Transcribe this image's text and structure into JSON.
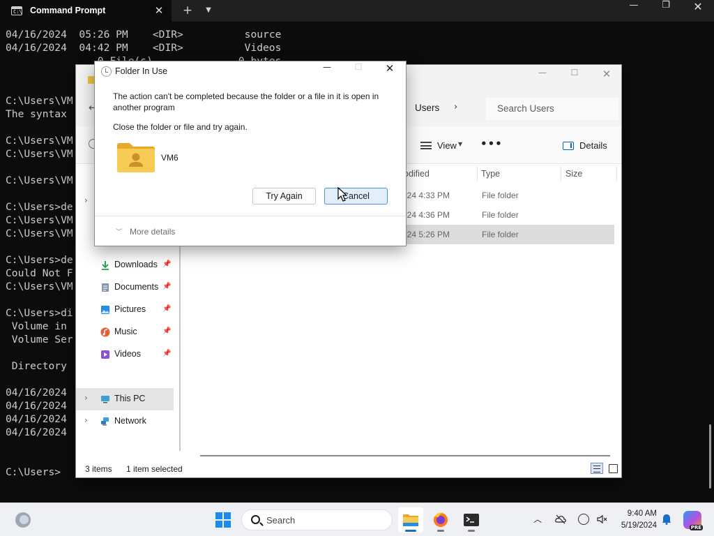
{
  "terminal": {
    "tab_title": "Command Prompt",
    "tab_icon_text": "C:\\",
    "lines": [
      "04/16/2024  05:26 PM    <DIR>          source",
      "04/16/2024  04:42 PM    <DIR>          Videos",
      "               0 File(s)              0 bytes",
      "",
      "",
      "C:\\Users\\VM",
      "The syntax",
      "",
      "C:\\Users\\VM",
      "C:\\Users\\VM",
      "",
      "C:\\Users\\VM",
      "",
      "C:\\Users>de",
      "C:\\Users\\VM",
      "C:\\Users\\VM",
      "",
      "C:\\Users>de",
      "Could Not F",
      "C:\\Users\\VM",
      "",
      "C:\\Users>di",
      " Volume in ",
      " Volume Ser",
      "",
      " Directory ",
      "",
      "04/16/2024",
      "04/16/2024",
      "04/16/2024",
      "04/16/2024",
      "",
      "",
      "C:\\Users>"
    ]
  },
  "explorer": {
    "breadcrumb": "Users",
    "search_placeholder": "Search Users",
    "toolbar": {
      "view_label": "View",
      "more_label": "•••",
      "details_label": "Details"
    },
    "nav": {
      "items": [
        {
          "label": "Downloads",
          "icon": "download-icon",
          "color": "#1f9e4b",
          "pinned": true
        },
        {
          "label": "Documents",
          "icon": "document-icon",
          "color": "#6b7f99",
          "pinned": true
        },
        {
          "label": "Pictures",
          "icon": "picture-icon",
          "color": "#2a8ce0",
          "pinned": true
        },
        {
          "label": "Music",
          "icon": "music-icon",
          "color": "#e0603a",
          "pinned": true
        },
        {
          "label": "Videos",
          "icon": "video-icon",
          "color": "#8a4fd6",
          "pinned": true
        }
      ],
      "this_pc": "This PC",
      "network": "Network"
    },
    "columns": {
      "modified": "odified",
      "type": "Type",
      "size": "Size"
    },
    "rows": [
      {
        "modified": "024 4:33 PM",
        "type": "File folder",
        "selected": false
      },
      {
        "modified": "024 4:36 PM",
        "type": "File folder",
        "selected": false
      },
      {
        "modified": "024 5:26 PM",
        "type": "File folder",
        "selected": true
      }
    ],
    "status": {
      "count": "3 items",
      "selected": "1 item selected"
    }
  },
  "dialog": {
    "title": "Folder In Use",
    "message": "The action can't be completed because the folder or a file in it is open in another program",
    "instruction": "Close the folder or file and try again.",
    "folder_name": "VM6",
    "try_again_label": "Try Again",
    "cancel_label": "Cancel",
    "more_details_label": "More details"
  },
  "taskbar": {
    "search_label": "Search",
    "time": "9:40 AM",
    "date": "5/19/2024",
    "copilot_badge": "PRE"
  },
  "colors": {
    "accent": "#0067c0",
    "folder_yellow": "#f4c142",
    "terminal_bg": "#0c0c0c",
    "terminal_text": "#cccccc"
  }
}
